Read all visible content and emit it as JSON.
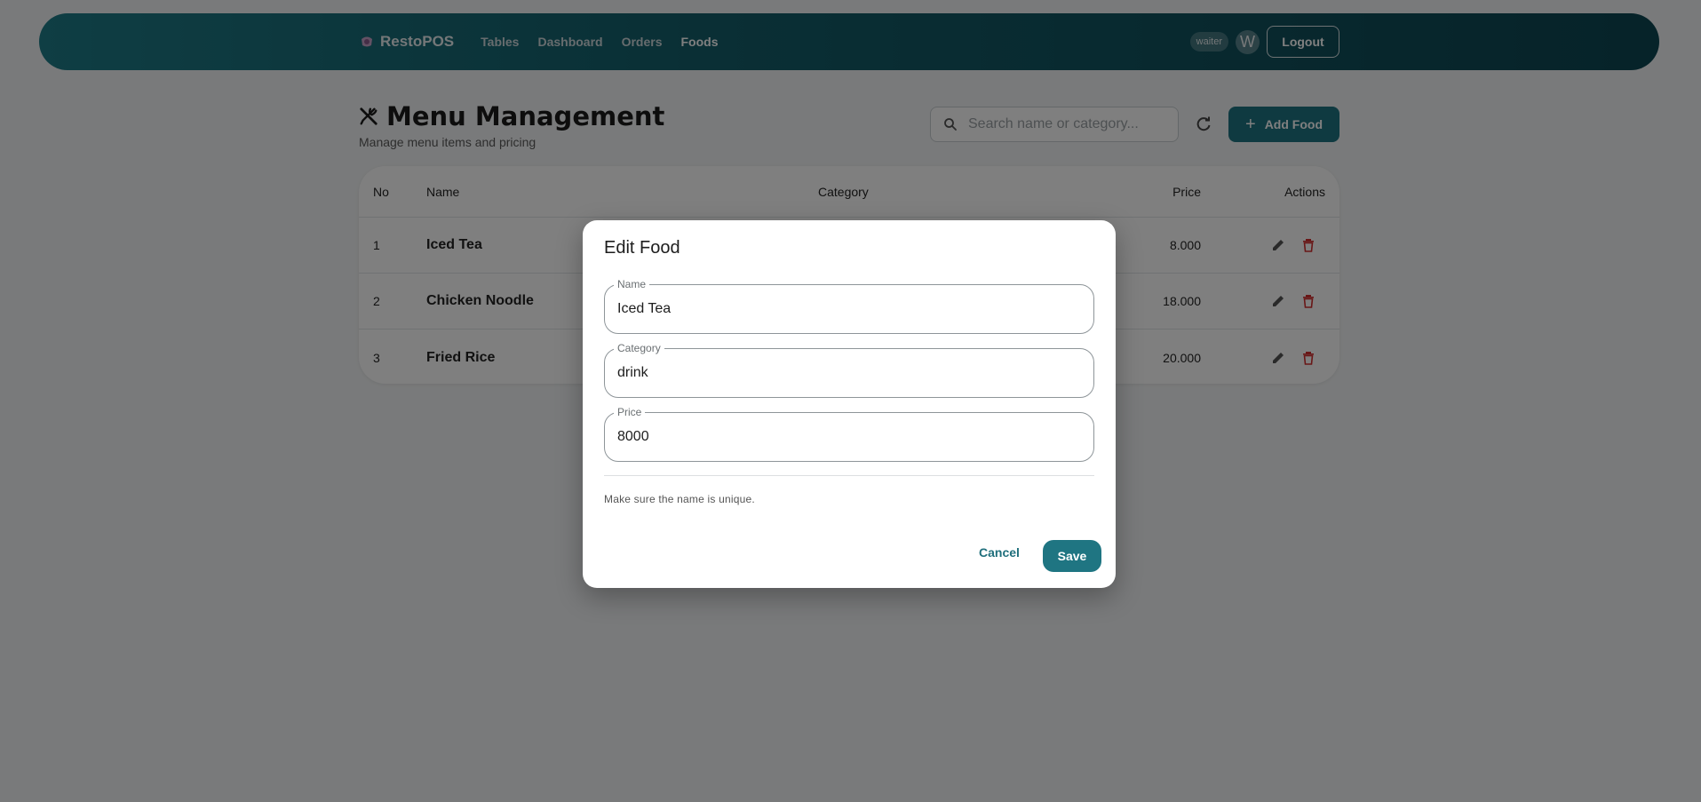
{
  "nav": {
    "brand": "RestoPOS",
    "links": [
      "Tables",
      "Dashboard",
      "Orders",
      "Foods"
    ],
    "active": "Foods",
    "role": "waiter",
    "avatar_initial": "W",
    "logout_label": "Logout"
  },
  "header": {
    "title": "Menu Management",
    "subtitle": "Manage menu items and pricing",
    "search_placeholder": "Search name or category...",
    "add_label": "Add Food"
  },
  "table": {
    "columns": {
      "no": "No",
      "name": "Name",
      "category": "Category",
      "price": "Price",
      "actions": "Actions"
    },
    "rows": [
      {
        "no": "1",
        "name": "Iced Tea",
        "price": "8.000"
      },
      {
        "no": "2",
        "name": "Chicken Noodle",
        "price": "18.000"
      },
      {
        "no": "3",
        "name": "Fried Rice",
        "price": "20.000"
      }
    ]
  },
  "dialog": {
    "title": "Edit Food",
    "fields": {
      "name": {
        "label": "Name",
        "value": "Iced Tea"
      },
      "category": {
        "label": "Category",
        "value": "drink"
      },
      "price": {
        "label": "Price",
        "value": "8000"
      }
    },
    "hint": "Make sure the name is unique.",
    "cancel_label": "Cancel",
    "save_label": "Save"
  },
  "colors": {
    "accent": "#1f7582",
    "danger": "#d32f2f"
  }
}
